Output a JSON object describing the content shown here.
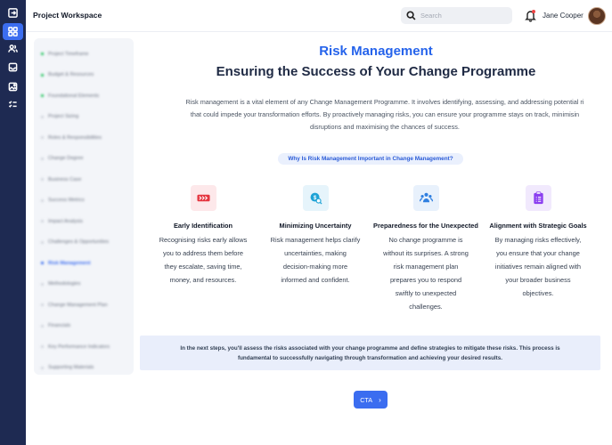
{
  "header": {
    "title": "Project Workspace",
    "search_placeholder": "Search",
    "user_name": "Jane Cooper"
  },
  "rail": {
    "items": [
      "exit-icon",
      "dashboard-icon",
      "users-icon",
      "inbox-icon",
      "image-icon",
      "checklist-icon"
    ],
    "active_index": 1
  },
  "outline": {
    "items": [
      {
        "label": "Project Timeframe",
        "state": "done"
      },
      {
        "label": "Budget & Resources",
        "state": "done"
      },
      {
        "label": "Foundational Elements",
        "state": "done"
      },
      {
        "label": "Project Sizing",
        "state": "todo"
      },
      {
        "label": "Roles & Responsibilities",
        "state": "todo"
      },
      {
        "label": "Change Degree",
        "state": "todo"
      },
      {
        "label": "Business Case",
        "state": "todo"
      },
      {
        "label": "Success Metrics",
        "state": "todo"
      },
      {
        "label": "Impact Analysis",
        "state": "todo"
      },
      {
        "label": "Challenges & Opportunities",
        "state": "todo"
      },
      {
        "label": "Risk Management",
        "state": "active"
      },
      {
        "label": "Methodologies",
        "state": "todo"
      },
      {
        "label": "Change Management Plan",
        "state": "todo"
      },
      {
        "label": "Financials",
        "state": "todo"
      },
      {
        "label": "Key Performance Indicators",
        "state": "todo"
      },
      {
        "label": "Supporting Materials",
        "state": "todo"
      }
    ]
  },
  "main": {
    "kicker": "Risk Management",
    "headline": "Ensuring the Success of Your Change Programme",
    "intro_lines": [
      "Risk management is a vital element of any Change Management Programme. It involves identifying, assessing, and addressing potential ri",
      "that could impede your transformation efforts. By proactively managing risks, you can ensure your programme stays on track, minimisin",
      "disruptions and maximising the chances of success."
    ],
    "pill": "Why Is Risk Management Important in Change Management?",
    "cards": [
      {
        "title": "Early Identification",
        "icon": "forward-arrows-icon",
        "icon_bg": "#fde8ea",
        "icon_color": "#e5353f",
        "lines": [
          "Recognising risks early allows",
          "you to address them before",
          "they escalate, saving time,",
          "money, and resources."
        ]
      },
      {
        "title": "Minimizing Uncertainty",
        "icon": "coin-search-icon",
        "icon_bg": "#e6f4fb",
        "icon_color": "#1fa3d6",
        "lines": [
          "Risk management helps clarify",
          "uncertainties, making",
          "decision-making more",
          "informed and confident."
        ]
      },
      {
        "title": "Preparedness for the Unexpected",
        "icon": "team-icon",
        "icon_bg": "#e8f1fc",
        "icon_color": "#2f7fe0",
        "lines": [
          "No change programme is",
          "without its surprises. A strong",
          "risk management plan",
          "prepares you to respond",
          "swiftly to unexpected",
          "challenges."
        ]
      },
      {
        "title": "Alignment with Strategic Goals",
        "icon": "clipboard-icon",
        "icon_bg": "#f1e9fd",
        "icon_color": "#8b3ff0",
        "lines": [
          "By managing risks effectively,",
          "you ensure that your change",
          "initiatives remain aligned with",
          "your broader business",
          "objectives."
        ]
      }
    ],
    "note_lines": [
      "In the next steps, you'll assess the risks associated with your change programme and define strategies to mitigate these risks. This process is",
      "fundamental to successfully navigating through transformation and achieving your desired results."
    ],
    "cta_label": "CTA"
  },
  "colors": {
    "rail": "#1e2a52",
    "accent": "#3b6df0",
    "kicker": "#2563eb",
    "note_bg": "#e9eefb"
  }
}
